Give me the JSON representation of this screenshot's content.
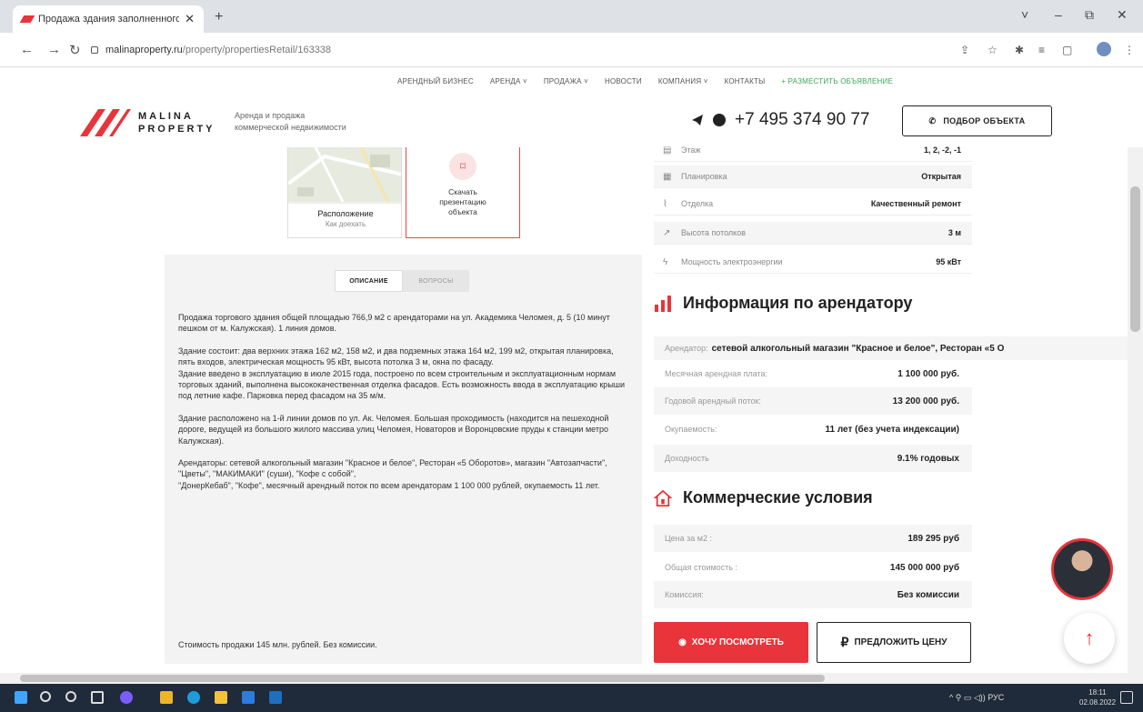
{
  "browser": {
    "tab_title": "Продажа здания заполненного",
    "url_host": "malinaproperty.ru",
    "url_path": "/property/propertiesRetail/163338"
  },
  "topnav": {
    "items": [
      "АРЕНДНЫЙ БИЗНЕС",
      "АРЕНДА ˅",
      "ПРОДАЖА ˅",
      "НОВОСТИ",
      "КОМПАНИЯ ˅",
      "КОНТАКТЫ"
    ],
    "post_ad": "+ РАЗМЕСТИТЬ ОБЪЯВЛЕНИЕ"
  },
  "header": {
    "logo_line1": "MALINA",
    "logo_line2": "PROPERTY",
    "tagline1": "Аренда и продажа",
    "tagline2": "коммерческой недвижимости",
    "phone": "+7 495 374 90 77",
    "select_button": "ПОДБОР ОБЪЕКТА"
  },
  "cards": {
    "location_title": "Расположение",
    "location_sub": "Как доехать",
    "download": "Скачать презентацию объекта"
  },
  "desc_tabs": {
    "description": "ОПИСАНИЕ",
    "questions": "ВОПРОСЫ"
  },
  "description": {
    "p1": "Продажа торгового здания общей площадью 766,9 м2 с арендаторами на ул. Академика Челомея, д. 5 (10 минут пешком от м. Калужская). 1 линия домов.",
    "p2": "Здание состоит: два верхних этажа 162 м2, 158 м2, и два подземных этажа 164 м2, 199 м2, открытая планировка, пять входов, электрическая мощность 95 кВт, высота потолка 3 м, окна по фасаду.",
    "p2b": "Здание введено в эксплуатацию в июле 2015 года, построено по всем строительным и эксплуатационным нормам торговых зданий, выполнена высококачественная отделка фасадов. Есть возможность ввода в эксплуатацию крыши под летние кафе. Парковка перед фасадом на 35 м/м.",
    "p3": "Здание расположено на 1-й линии домов по ул. Ак. Челомея. Большая проходимость (находится на пешеходной дороге, ведущей из большого жилого массива улиц Челомея, Новаторов и Воронцовские пруды к станции метро Калужская).",
    "p4": "Арендаторы: сетевой алкогольный магазин \"Красное и белое\", Ресторан «5 Оборотов», магазин \"Автозапчасти\", \"Цветы\", \"МАКИМАКИ\" (суши), \"Кофе с собой\",",
    "p4b": "\"ДонерКебаб\", \"Кофе\", месячный арендный поток по всем арендаторам 1 100 000 рублей, окупаемость 11 лет.",
    "price_note": "Стоимость продажи 145 млн. рублей. Без комиссии."
  },
  "specs": [
    {
      "label": "Этаж",
      "value": "1, 2, -2, -1"
    },
    {
      "label": "Планировка",
      "value": "Открытая"
    },
    {
      "label": "Отделка",
      "value": "Качественный ремонт"
    },
    {
      "label": "Высота потолков",
      "value": "3 м"
    },
    {
      "label": "Мощность электроэнергии",
      "value": "95 кВт"
    }
  ],
  "tenant_section": {
    "title": "Информация по арендатору",
    "tenant_label": "Арендатор:",
    "tenant_value": "сетевой алкогольный магазин \"Красное и белое\", Ресторан «5 О",
    "rows": [
      {
        "label": "Месячная арендная плата:",
        "value": "1 100 000 руб."
      },
      {
        "label": "Годовой арендный поток:",
        "value": "13 200 000 руб."
      },
      {
        "label": "Окупаемость:",
        "value": "11 лет (без учета индексации)"
      },
      {
        "label": "Доходность",
        "value": "9.1% годовых"
      }
    ]
  },
  "commercial": {
    "title": "Коммерческие условия",
    "rows": [
      {
        "label": "Цена за м2 :",
        "value": "189 295 руб"
      },
      {
        "label": "Общая стоимость :",
        "value": "145 000 000 руб"
      },
      {
        "label": "Комиссия:",
        "value": "Без комиссии"
      }
    ]
  },
  "actions": {
    "want_to_see": "ХОЧУ ПОСМОТРЕТЬ",
    "offer_price": "ПРЕДЛОЖИТЬ ЦЕНУ"
  },
  "taskbar": {
    "tray": "РУС",
    "time": "18:11",
    "date": "02.08.2022"
  },
  "colors": {
    "accent": "#e8343a",
    "green": "#3aa55a"
  }
}
